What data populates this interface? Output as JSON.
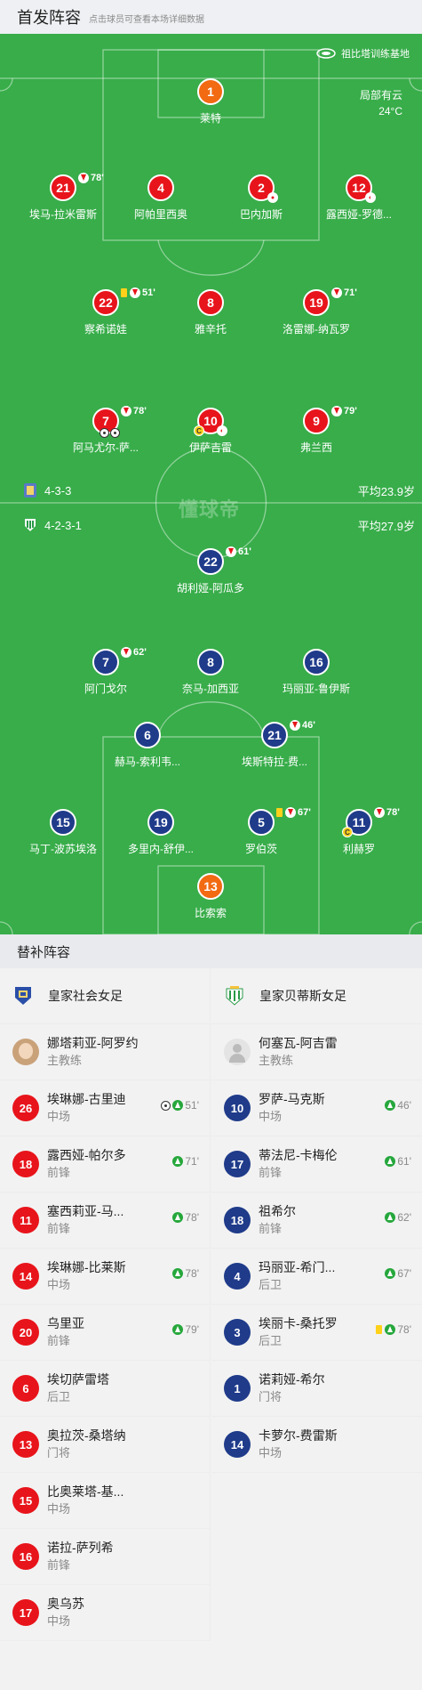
{
  "header": {
    "title": "首发阵容",
    "hint": "点击球员可查看本场详细数据"
  },
  "pitch": {
    "venue": "祖比塔训练基地",
    "weather": "局部有云",
    "temperature": "24°C",
    "watermark": "懂球帝",
    "home": {
      "formation": "4-3-3",
      "avg_age": "平均23.9岁"
    },
    "away": {
      "formation": "4-2-3-1",
      "avg_age": "平均27.9岁"
    }
  },
  "home_lineup": {
    "gk": {
      "num": "1",
      "name": "莱特"
    },
    "p21": {
      "num": "21",
      "name": "埃马-拉米雷斯",
      "sub": "78'"
    },
    "p4": {
      "num": "4",
      "name": "阿帕里西奥"
    },
    "p2": {
      "num": "2",
      "name": "巴内加斯"
    },
    "p12": {
      "num": "12",
      "name": "露西娅-罗德..."
    },
    "p22": {
      "num": "22",
      "name": "察希诺娃",
      "sub": "51'"
    },
    "p8": {
      "num": "8",
      "name": "雅辛托"
    },
    "p19": {
      "num": "19",
      "name": "洛雷娜-纳瓦罗",
      "sub": "71'"
    },
    "p7": {
      "num": "7",
      "name": "阿马尤尔-萨...",
      "sub": "78'"
    },
    "p10": {
      "num": "10",
      "name": "伊萨吉雷"
    },
    "p9": {
      "num": "9",
      "name": "弗兰西",
      "sub": "79'"
    }
  },
  "away_lineup": {
    "p22": {
      "num": "22",
      "name": "胡利娅-阿瓜多",
      "sub": "61'"
    },
    "p7": {
      "num": "7",
      "name": "阿门戈尔",
      "sub": "62'"
    },
    "p8": {
      "num": "8",
      "name": "奈马-加西亚"
    },
    "p16": {
      "num": "16",
      "name": "玛丽亚-鲁伊斯"
    },
    "p6": {
      "num": "6",
      "name": "赫马-索利韦..."
    },
    "p21": {
      "num": "21",
      "name": "埃斯特拉-费...",
      "sub": "46'"
    },
    "p15": {
      "num": "15",
      "name": "马丁-波苏埃洛"
    },
    "p19": {
      "num": "19",
      "name": "多里内-舒伊..."
    },
    "p5": {
      "num": "5",
      "name": "罗伯茨",
      "sub": "67'"
    },
    "p11": {
      "num": "11",
      "name": "利赫罗",
      "sub": "78'"
    },
    "gk": {
      "num": "13",
      "name": "比索索"
    }
  },
  "bench": {
    "title": "替补阵容",
    "home": {
      "team": "皇家社会女足",
      "coach": {
        "name": "娜塔莉亚-阿罗约",
        "role": "主教练"
      },
      "players": [
        {
          "num": "26",
          "name": "埃琳娜-古里迪",
          "pos": "中场",
          "min": "51'"
        },
        {
          "num": "18",
          "name": "露西娅-帕尔多",
          "pos": "前锋",
          "min": "71'"
        },
        {
          "num": "11",
          "name": "塞西莉亚-马...",
          "pos": "前锋",
          "min": "78'"
        },
        {
          "num": "14",
          "name": "埃琳娜-比莱斯",
          "pos": "中场",
          "min": "78'"
        },
        {
          "num": "20",
          "name": "乌里亚",
          "pos": "前锋",
          "min": "79'"
        },
        {
          "num": "6",
          "name": "埃切萨雷塔",
          "pos": "后卫"
        },
        {
          "num": "13",
          "name": "奥拉茨-桑塔纳",
          "pos": "门将"
        },
        {
          "num": "15",
          "name": "比奥莱塔-基...",
          "pos": "中场"
        },
        {
          "num": "16",
          "name": "诺拉-萨列希",
          "pos": "前锋"
        },
        {
          "num": "17",
          "name": "奥乌苏",
          "pos": "中场"
        }
      ]
    },
    "away": {
      "team": "皇家贝蒂斯女足",
      "coach": {
        "name": "何塞瓦-阿吉雷",
        "role": "主教练"
      },
      "players": [
        {
          "num": "10",
          "name": "罗萨-马克斯",
          "pos": "中场",
          "min": "46'"
        },
        {
          "num": "17",
          "name": "蒂法尼-卡梅伦",
          "pos": "前锋",
          "min": "61'"
        },
        {
          "num": "18",
          "name": "祖希尔",
          "pos": "前锋",
          "min": "62'"
        },
        {
          "num": "4",
          "name": "玛丽亚-希门...",
          "pos": "后卫",
          "min": "67'"
        },
        {
          "num": "3",
          "name": "埃丽卡-桑托罗",
          "pos": "后卫",
          "min": "78'"
        },
        {
          "num": "1",
          "name": "诺莉娅-希尔",
          "pos": "门将"
        },
        {
          "num": "14",
          "name": "卡萝尔-费雷斯",
          "pos": "中场"
        }
      ]
    }
  },
  "colors": {
    "pitch": "#38ad4a",
    "home": "#e8141b",
    "away": "#1f3b8a",
    "keeper": "#f26a12"
  }
}
